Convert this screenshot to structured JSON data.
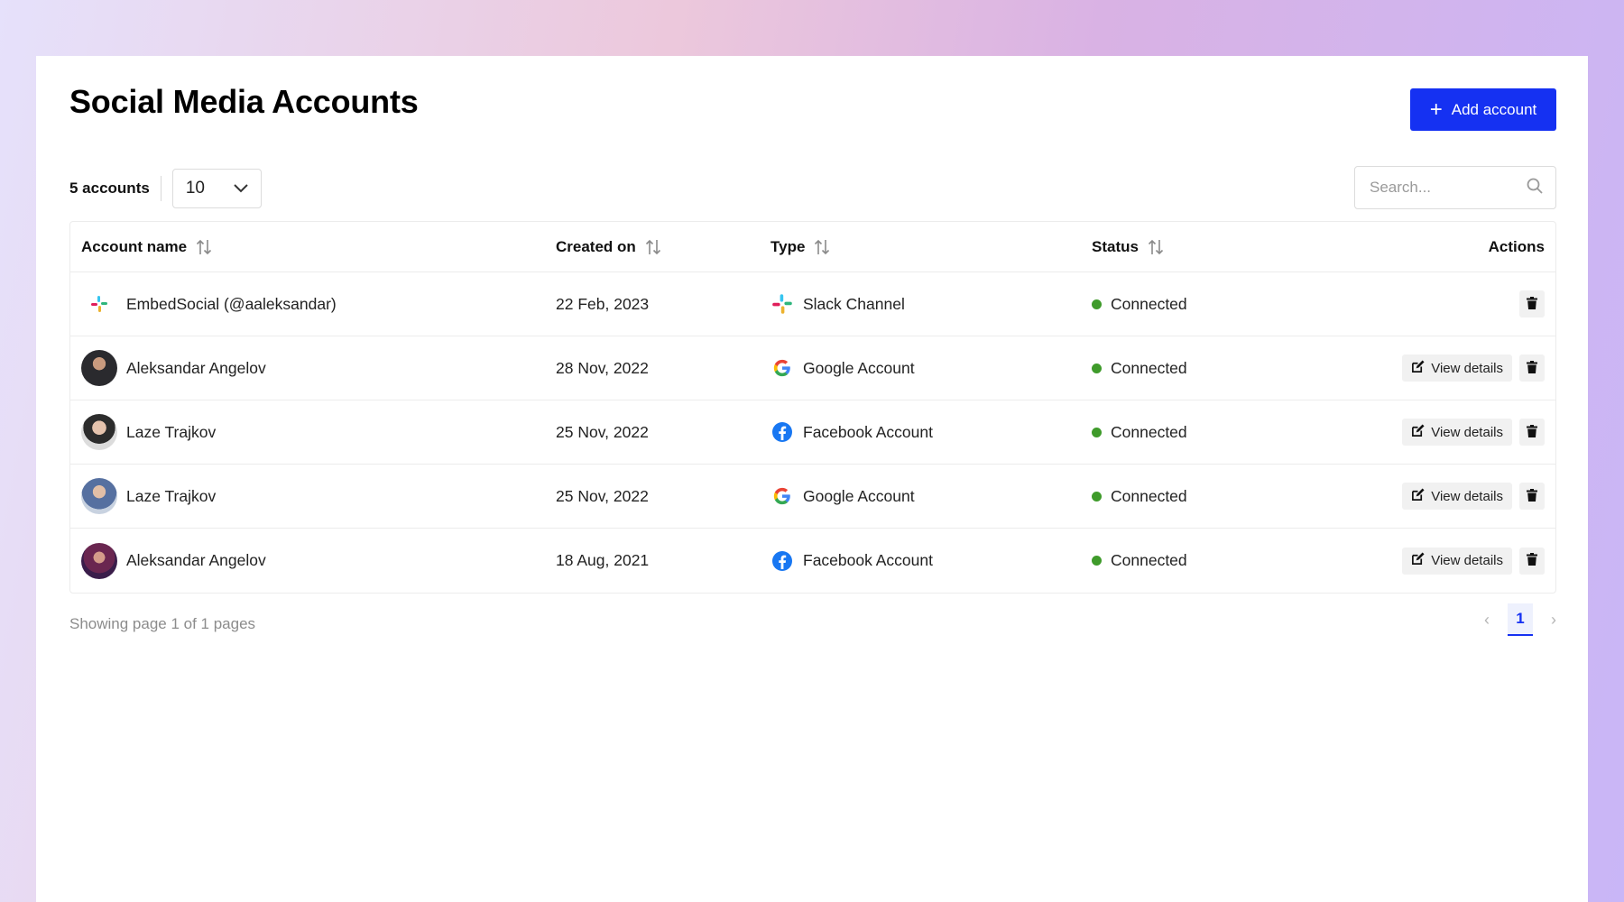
{
  "header": {
    "title": "Social Media Accounts",
    "add_button_label": "Add account",
    "accent_color": "#1531f2"
  },
  "toolbar": {
    "count_label": "5 accounts",
    "per_page_value": "10",
    "search_placeholder": "Search..."
  },
  "table": {
    "columns": [
      "Account name",
      "Created on",
      "Type",
      "Status",
      "Actions"
    ],
    "rows": [
      {
        "name": "EmbedSocial (@aaleksandar)",
        "created": "22 Feb, 2023",
        "type": "Slack Channel",
        "type_icon": "slack-icon",
        "status": "Connected",
        "avatar": "slack-logo",
        "has_details": false
      },
      {
        "name": "Aleksandar Angelov",
        "created": "28 Nov, 2022",
        "type": "Google Account",
        "type_icon": "google-icon",
        "status": "Connected",
        "avatar": "photo",
        "has_details": true
      },
      {
        "name": "Laze Trajkov",
        "created": "25 Nov, 2022",
        "type": "Facebook Account",
        "type_icon": "facebook-icon",
        "status": "Connected",
        "avatar": "photo",
        "has_details": true
      },
      {
        "name": "Laze Trajkov",
        "created": "25 Nov, 2022",
        "type": "Google Account",
        "type_icon": "google-icon",
        "status": "Connected",
        "avatar": "photo",
        "has_details": true
      },
      {
        "name": "Aleksandar Angelov",
        "created": "18 Aug, 2021",
        "type": "Facebook Account",
        "type_icon": "facebook-icon",
        "status": "Connected",
        "avatar": "photo",
        "has_details": true
      }
    ],
    "view_details_label": "View details",
    "status_color": "#3f9b2b"
  },
  "footer": {
    "pagination_text": "Showing page 1 of 1 pages",
    "current_page": "1"
  }
}
